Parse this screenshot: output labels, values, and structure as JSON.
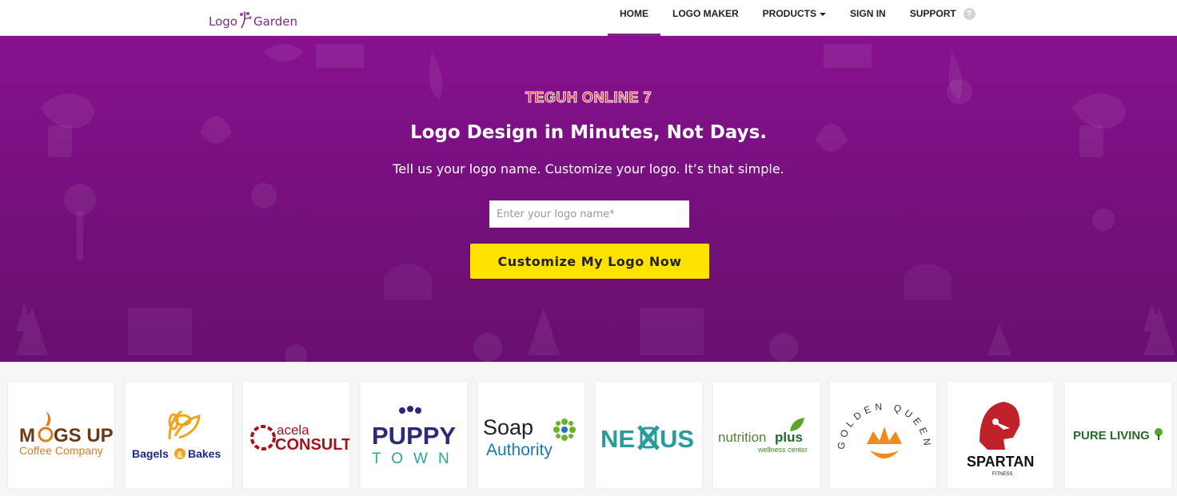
{
  "header": {
    "brand_left": "Logo",
    "brand_right": "Garden",
    "brand_color": "#7a2a86",
    "nav": [
      {
        "label": "HOME",
        "active": true
      },
      {
        "label": "LOGO MAKER",
        "active": false
      },
      {
        "label": "PRODUCTS",
        "active": false,
        "dropdown": true
      },
      {
        "label": "SIGN IN",
        "active": false
      },
      {
        "label": "SUPPORT",
        "active": false,
        "help_icon": "question-icon"
      }
    ],
    "help_glyph": "?"
  },
  "hero": {
    "watermark": "TEGUH ONLINE 7",
    "title": "Logo Design in Minutes, Not Days.",
    "subtitle": "Tell us your logo name. Customize your logo. It’s that simple.",
    "input_placeholder": "Enter your logo name*",
    "input_value": "",
    "cta_label": "Customize My Logo Now",
    "bg_color": "#7e1085",
    "cta_color": "#ffe300"
  },
  "logos": [
    {
      "line1": "M",
      "line1b": "GS UP",
      "line2": "Coffee Company",
      "icon": "coffee-cup-icon"
    },
    {
      "line1": "Bagels",
      "amp": "&",
      "line2": "Bakes",
      "icon": "wheat-icon"
    },
    {
      "line1": "acela",
      "line2": "CONSULT",
      "icon": "wreath-icon"
    },
    {
      "line1": "PUPPY",
      "line2": "TOWN",
      "icon": "dog-icon"
    },
    {
      "line1": "Soap",
      "line2": "Authority",
      "icon": "flower-icon"
    },
    {
      "line1": "NE",
      "line1b": "US",
      "icon": "knot-icon"
    },
    {
      "line1": "nutrition",
      "line1b": "plus",
      "line2": "wellness center",
      "icon": "leaf-icon"
    },
    {
      "line1": "GOLDEN QUEEN",
      "icon": "crown-icon"
    },
    {
      "line1": "SPARTAN",
      "line2": "FITNESS",
      "icon": "helmet-icon"
    },
    {
      "line1": "PURE LIVING",
      "icon": "tree-icon"
    }
  ]
}
